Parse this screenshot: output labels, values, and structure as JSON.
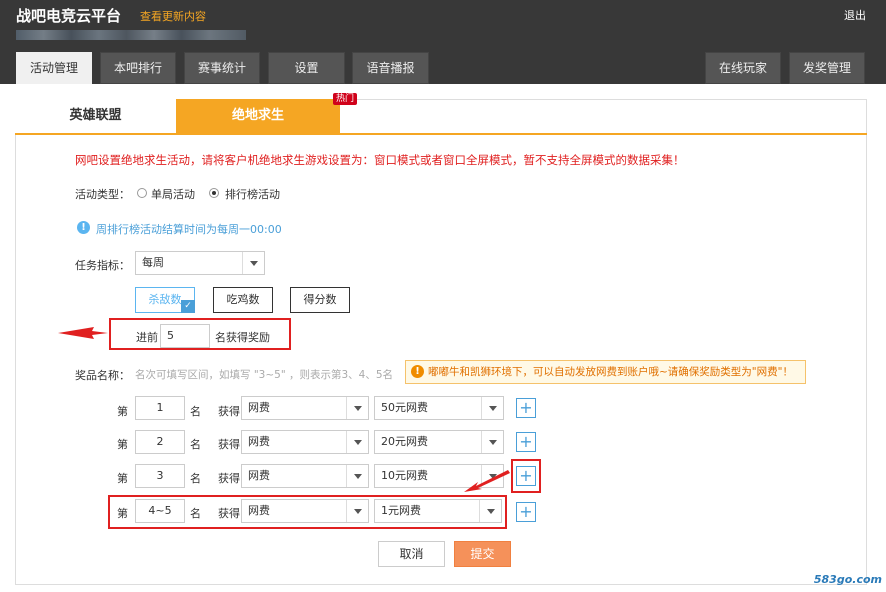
{
  "header": {
    "brand": "战吧电竞云平台",
    "update_link": "查看更新内容",
    "logout": "退出",
    "tabs": [
      "活动管理",
      "本吧排行",
      "赛事统计",
      "设置",
      "语音播报"
    ],
    "right_tabs": [
      "在线玩家",
      "发奖管理"
    ]
  },
  "game_tabs": {
    "lol": "英雄联盟",
    "pubg": "绝地求生",
    "hot": "热门"
  },
  "form": {
    "warning": "网吧设置绝地求生活动，请将客户机绝地求生游戏设置为：窗口模式或者窗口全屏模式，暂不支持全屏模式的数据采集！",
    "activity_type_label": "活动类型：",
    "activity_type_options": [
      "单局活动",
      "排行榜活动"
    ],
    "info_text": "周排行榜活动结算时间为每周一00:00",
    "task_index_label": "任务指标：",
    "task_index_value": "每周",
    "metrics": [
      "杀敌数",
      "吃鸡数",
      "得分数"
    ],
    "top_prefix": "进前",
    "top_value": "5",
    "top_suffix": "名获得奖励",
    "prize_label": "奖品名称：",
    "prize_hint": "名次可填写区间，如填写 \"3~5\" ，则表示第3、4、5名",
    "notice": "嘟嘟牛和凯狮环境下，可以自动发放网费到账户哦~请确保奖励类型为\"网费\"！"
  },
  "prize_rows": [
    {
      "prefix": "第",
      "rank": "1",
      "suffix": "名",
      "get": "获得",
      "type": "网费",
      "amount": "50元网费"
    },
    {
      "prefix": "第",
      "rank": "2",
      "suffix": "名",
      "get": "获得",
      "type": "网费",
      "amount": "20元网费"
    },
    {
      "prefix": "第",
      "rank": "3",
      "suffix": "名",
      "get": "获得",
      "type": "网费",
      "amount": "10元网费"
    },
    {
      "prefix": "第",
      "rank": "4~5",
      "suffix": "名",
      "get": "获得",
      "type": "网费",
      "amount": "1元网费"
    }
  ],
  "buttons": {
    "cancel": "取消",
    "submit": "提交"
  },
  "watermark": "583go.com",
  "colors": {
    "accent": "#f5a623",
    "warning": "#e02020",
    "info": "#4a9fd8",
    "topbar": "#383838",
    "submit": "#f5915a"
  }
}
